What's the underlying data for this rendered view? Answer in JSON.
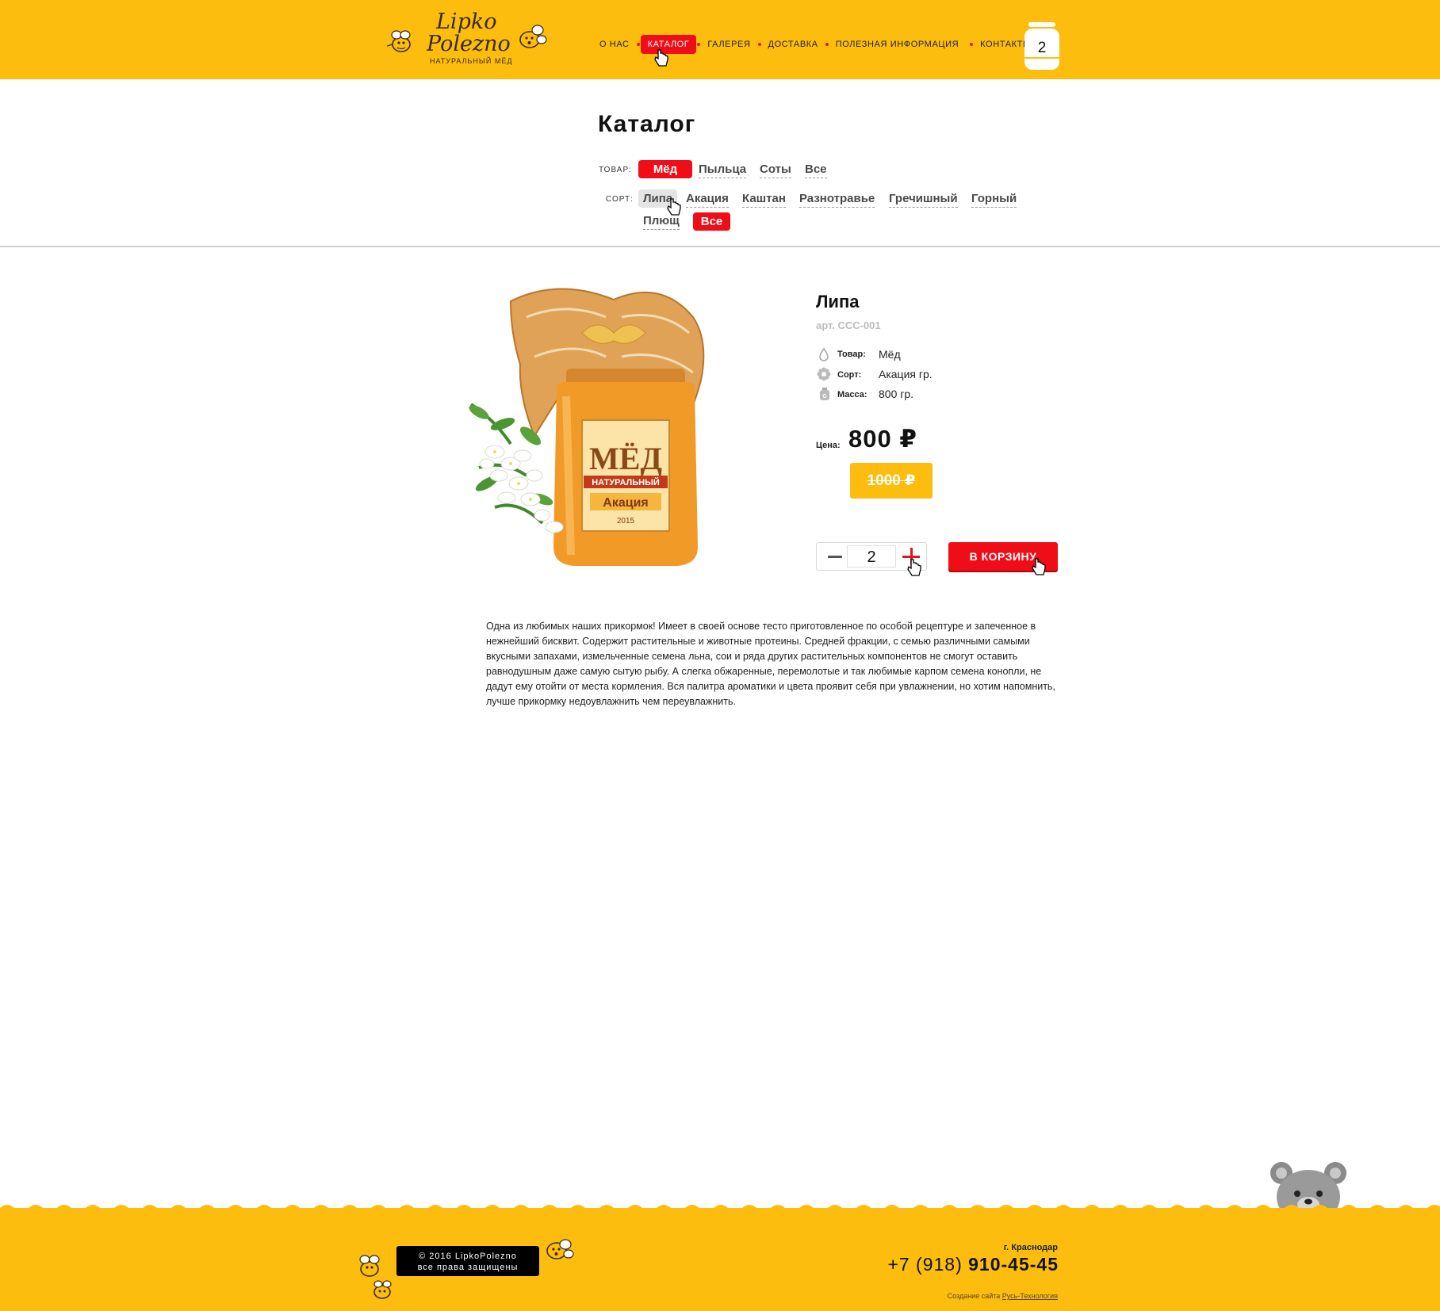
{
  "header": {
    "logo": {
      "line1": "Lipko",
      "line2": "Polezno",
      "tagline": "НАТУРАЛЬНЫЙ МЁД"
    },
    "nav": [
      {
        "label": "О НАС",
        "active": false
      },
      {
        "label": "КАТАЛОГ",
        "active": true
      },
      {
        "label": "ГАЛЕРЕЯ",
        "active": false
      },
      {
        "label": "ДОСТАВКА",
        "active": false
      },
      {
        "label": "ПОЛЕЗНАЯ ИНФОРМАЦИЯ",
        "active": false
      },
      {
        "label": "КОНТАКТЫ",
        "active": false
      }
    ],
    "cart_count": "2"
  },
  "catalog": {
    "title": "Каталог",
    "product_filter": {
      "label": "ТОВАР:",
      "options": [
        "Мёд",
        "Пыльца",
        "Соты",
        "Все"
      ],
      "selected": "Мёд"
    },
    "sort_filter": {
      "label": "СОРТ:",
      "options": [
        "Липа",
        "Акация",
        "Каштан",
        "Разнотравье",
        "Гречишный",
        "Горный",
        "Плющ",
        "Все"
      ],
      "hovered": "Липа",
      "selected": "Все"
    }
  },
  "product": {
    "image_label": {
      "title": "МЁД",
      "subtitle": "НАТУРАЛЬНЫЙ",
      "sort": "Акация",
      "year": "2015"
    },
    "name": "Липа",
    "article": "арт. ССС-001",
    "attributes": [
      {
        "icon": "drop-icon",
        "label": "Товар:",
        "value": "Мёд"
      },
      {
        "icon": "flower-icon",
        "label": "Сорт:",
        "value": "Акация гр."
      },
      {
        "icon": "weight-icon",
        "label": "Масса:",
        "value": "800 гр."
      }
    ],
    "price_label": "Цена:",
    "price": "800 ₽",
    "old_price": "1000 ₽",
    "quantity": "2",
    "buy_label": "В КОРЗИНУ",
    "description": "Одна из любимых наших прикормок! Имеет в своей основе тесто приготовленное по особой рецептуре и запеченное в нежнейший бисквит. Содержит растительные и животные протеины. Средней фракции, с семью различными самыми вкусными запахами, измельченные семена льна, сои и ряда других растительных компонентов не смогут оставить равнодушным даже самую сытую рыбу. А слегка обжаренные, перемолотые и так любимые карпом семена конопли, не дадут ему отойти от места кормления. Вся палитра ароматики и цвета проявит себя при увлажнении, но хотим напомнить, лучше прикормку недоувлажнить чем переувлажнить."
  },
  "footer": {
    "copyright_line1": "© 2016 LipkoPolezno",
    "copyright_line2": "все права защищены",
    "city": "г. Краснодар",
    "phone_prefix": "+7 (918) ",
    "phone_number": "910-45-45",
    "credit_text": "Создание сайта ",
    "credit_link": "Русь-Технология"
  },
  "colors": {
    "brand_yellow": "#fcbd0e",
    "accent_red": "#ef0d17",
    "text_dark": "#111111",
    "muted_grey": "#bcbcbc"
  }
}
